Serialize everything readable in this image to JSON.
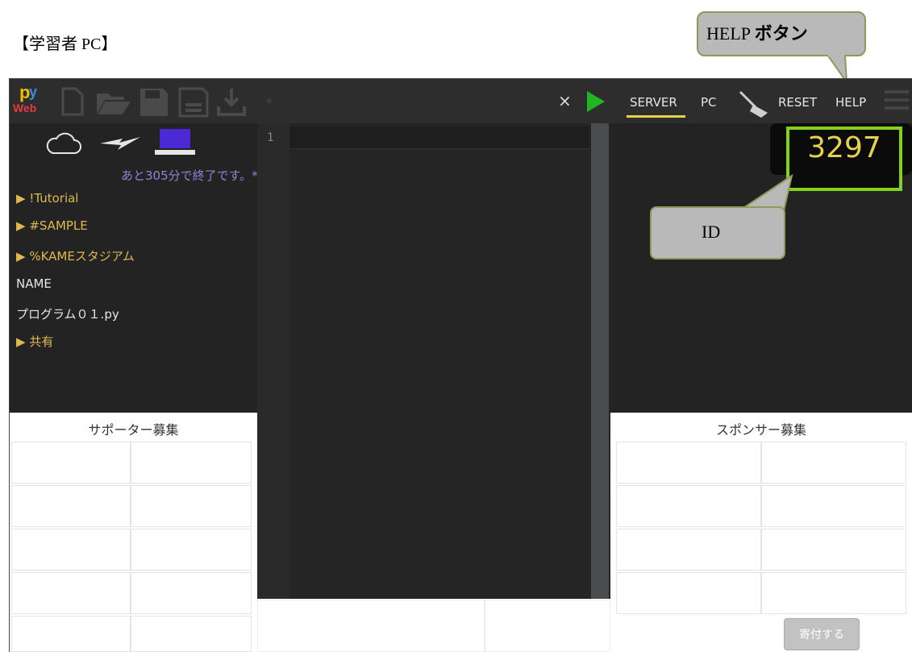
{
  "doc_caption": "【学習者 PC】",
  "callouts": {
    "help": {
      "prefix": "HELP ",
      "bold": "ボタン"
    },
    "id": "ID"
  },
  "left_panel": {
    "toolbar_icons": [
      "new-file-icon",
      "open-folder-icon",
      "save-icon",
      "save-as-icon",
      "download-icon"
    ],
    "status_icons": [
      "cloud-icon",
      "lightning-icon",
      "laptop-icon"
    ],
    "status_text": "あと305分で終了です。***",
    "tree": [
      {
        "label": "!Tutorial",
        "type": "folder"
      },
      {
        "label": "#SAMPLE",
        "type": "folder"
      },
      {
        "label": "%KAMEスタジアム",
        "type": "folder"
      },
      {
        "label": "NAME",
        "type": "text"
      },
      {
        "label": "プログラム０１.py",
        "type": "file"
      },
      {
        "label": "共有",
        "type": "folder"
      }
    ],
    "supporter_title": "サポーター募集"
  },
  "editor": {
    "line_numbers": [
      "1"
    ],
    "close_label": "×"
  },
  "right_panel": {
    "nav": {
      "server": "SERVER",
      "pc": "PC",
      "reset": "RESET",
      "help": "HELP"
    },
    "id_value": "3297",
    "sponsor_title": "スポンサー募集",
    "donate_label": "寄付する"
  },
  "colors": {
    "accent_yellow": "#e6d24d",
    "id_border_green": "#84d11b",
    "run_green": "#21b521",
    "tree_folder": "#e0b84d",
    "status_purple": "#8c85d8"
  }
}
